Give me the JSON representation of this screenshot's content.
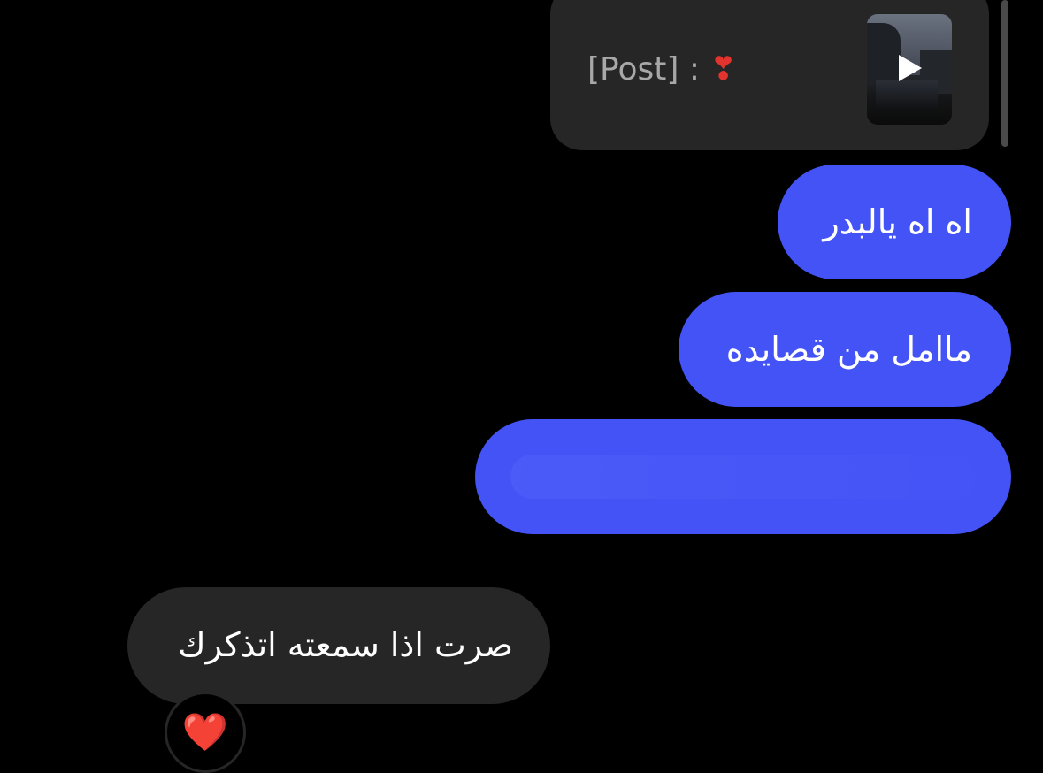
{
  "chat": {
    "shared_post": {
      "label": "[Post] : ",
      "mark": "❣",
      "thumbnail": "video-thumbnail",
      "thumbnail_icon": "play-icon"
    },
    "messages": [
      {
        "side": "sent",
        "text": "اه اه يالبدر"
      },
      {
        "side": "sent",
        "text": "ماامل من قصايده"
      },
      {
        "side": "sent",
        "text": ""
      },
      {
        "side": "received",
        "text": "صرت اذا سمعته اتذكرك"
      }
    ],
    "reaction": {
      "emoji": "❤️",
      "icon": "heart-reaction-icon"
    }
  },
  "colors": {
    "background": "#000000",
    "sent_bubble": "#4353f6",
    "received_bubble": "#262626",
    "secondary_text": "#a8a8a8",
    "accent_red": "#e3332e"
  }
}
